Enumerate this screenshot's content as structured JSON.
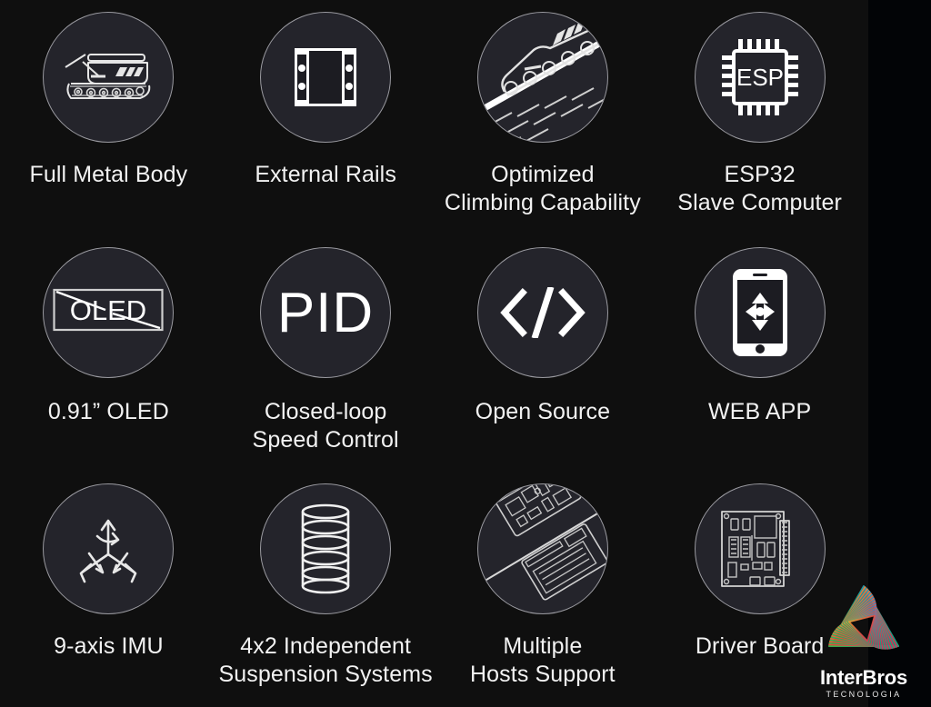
{
  "background": {
    "main_color": "#0f0f0f",
    "right_panel_color": "#020406"
  },
  "badge_style": {
    "fill": "#24242b",
    "border": "#9a9aa0",
    "icon_color": "#ffffff"
  },
  "features": [
    {
      "icon": "tracked-tank-icon",
      "label": "Full Metal Body"
    },
    {
      "icon": "external-rails-icon",
      "label": "External Rails"
    },
    {
      "icon": "tank-climbing-slope-icon",
      "label": "Optimized\nClimbing Capability"
    },
    {
      "icon": "esp-chip-icon",
      "label": "ESP32\nSlave Computer"
    },
    {
      "icon": "oled-screen-icon",
      "label": "0.91” OLED"
    },
    {
      "icon": "pid-text-icon",
      "label": "Closed-loop\nSpeed Control"
    },
    {
      "icon": "code-brackets-icon",
      "label": "Open Source"
    },
    {
      "icon": "smartphone-dpad-icon",
      "label": "WEB APP"
    },
    {
      "icon": "three-axis-arrows-icon",
      "label": "9-axis IMU"
    },
    {
      "icon": "coil-spring-icon",
      "label": "4x2 Independent\nSuspension Systems"
    },
    {
      "icon": "two-boards-split-icon",
      "label": "Multiple\nHosts Support"
    },
    {
      "icon": "driver-pcb-icon",
      "label": "Driver Board"
    }
  ],
  "icon_text": {
    "esp": "ESP",
    "oled": "OLED",
    "pid": "PID"
  },
  "logo": {
    "name": "InterBros",
    "tagline": "TECNOLOGIA",
    "colors": [
      "#f5a524",
      "#ef4b3c",
      "#e03a5f",
      "#2f8fd8",
      "#19a974",
      "#3ab54a"
    ]
  }
}
